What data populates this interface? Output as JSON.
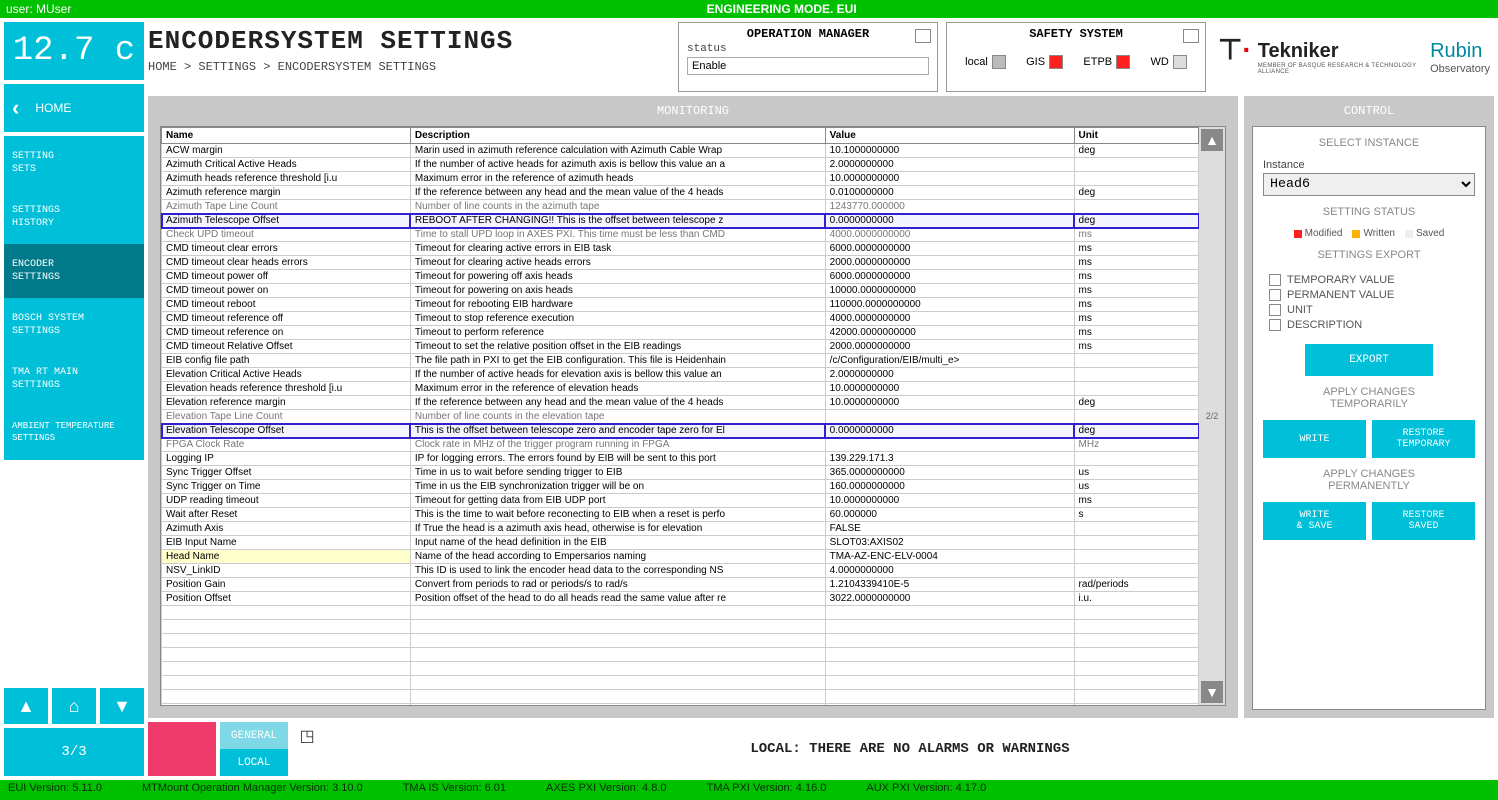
{
  "top": {
    "user": "user: MUser",
    "mode": "ENGINEERING MODE. EUI"
  },
  "version_badge": "12.7 c",
  "nav": {
    "back": "HOME",
    "items": [
      {
        "label": "SETTING\nSETS"
      },
      {
        "label": "SETTINGS\nHISTORY"
      },
      {
        "label": "ENCODER\nSETTINGS",
        "active": true
      },
      {
        "label": "BOSCH SYSTEM\nSETTINGS"
      },
      {
        "label": "TMA RT MAIN\nSETTINGS"
      },
      {
        "label": "AMBIENT TEMPERATURE\nSETTINGS",
        "small": true
      }
    ],
    "page": "3/3"
  },
  "title": "ENCODERSYSTEM SETTINGS",
  "breadcrumb": "HOME > SETTINGS > ENCODERSYSTEM SETTINGS",
  "op_mgr": {
    "title": "OPERATION MANAGER",
    "status_label": "status",
    "status_value": "Enable"
  },
  "safety": {
    "title": "SAFETY SYSTEM",
    "items": [
      {
        "label": "local",
        "color": "#bbb"
      },
      {
        "label": "GIS",
        "color": "#ff2020"
      },
      {
        "label": "ETPB",
        "color": "#ff2020"
      },
      {
        "label": "WD",
        "color": "#ddd"
      }
    ]
  },
  "logos": {
    "tek": "Tekniker",
    "tek_sub": "MEMBER OF BASQUE RESEARCH\n& TECHNOLOGY ALLIANCE",
    "rubin": "Rubin",
    "rubin_sub": "Observatory"
  },
  "monitoring": {
    "title": "MONITORING",
    "cols": [
      "Name",
      "Description",
      "Value",
      "Unit"
    ],
    "page": "2/2",
    "rows": [
      {
        "n": "ACW margin",
        "d": "Marin used in azimuth reference calculation with Azimuth Cable Wrap",
        "v": "10.1000000000",
        "u": "deg"
      },
      {
        "n": "Azimuth Critical Active Heads",
        "d": "If the number of active heads for azimuth axis is bellow this value an a",
        "v": "2.0000000000",
        "u": ""
      },
      {
        "n": "Azimuth heads reference threshold [i.u",
        "d": "Maximum error in the reference of azimuth heads",
        "v": "10.0000000000",
        "u": ""
      },
      {
        "n": "Azimuth reference margin",
        "d": "If the reference between any head and the mean value of the 4 heads",
        "v": "0.0100000000",
        "u": "deg"
      },
      {
        "n": "Azimuth Tape Line Count",
        "d": "Number of line counts in the azimuth tape",
        "v": "1243770.000000",
        "u": "",
        "obs": true
      },
      {
        "n": "Azimuth Telescope Offset",
        "d": "REBOOT AFTER CHANGING!! This is the offset between telescope z",
        "v": "0.0000000000",
        "u": "deg",
        "hl": true
      },
      {
        "n": "Check UPD timeout",
        "d": "Time to stall UPD loop in AXES PXI. This time must be less than CMD",
        "v": "4000.0000000000",
        "u": "ms",
        "obs": true
      },
      {
        "n": "CMD timeout clear errors",
        "d": "Timeout for  clearing active errors in EIB task",
        "v": "6000.0000000000",
        "u": "ms"
      },
      {
        "n": "CMD timeout clear heads errors",
        "d": "Timeout for  clearing active heads errors",
        "v": "2000.0000000000",
        "u": "ms"
      },
      {
        "n": "CMD timeout power off",
        "d": "Timeout for  powering off axis heads",
        "v": "6000.0000000000",
        "u": "ms"
      },
      {
        "n": "CMD timeout power on",
        "d": "Timeout for  powering on axis heads",
        "v": "10000.0000000000",
        "u": "ms"
      },
      {
        "n": "CMD timeout reboot",
        "d": "Timeout for rebooting EIB hardware",
        "v": "110000.0000000000",
        "u": "ms"
      },
      {
        "n": "CMD timeout reference off",
        "d": "Timeout to stop reference execution",
        "v": "4000.0000000000",
        "u": "ms"
      },
      {
        "n": "CMD timeout reference on",
        "d": "Timeout to perform reference",
        "v": "42000.0000000000",
        "u": "ms"
      },
      {
        "n": "CMD timeout Relative Offset",
        "d": "Timeout to set the relative position offset in the EIB readings",
        "v": "2000.0000000000",
        "u": "ms"
      },
      {
        "n": "EIB config file path",
        "d": "The file path in PXI to get the EIB configuration. This file is Heidenhain",
        "v": "/c/Configuration/EIB/multi_e>",
        "u": ""
      },
      {
        "n": "Elevation Critical Active Heads",
        "d": "If the number of active heads for elevation axis is bellow this value an",
        "v": "2.0000000000",
        "u": ""
      },
      {
        "n": "Elevation heads reference threshold [i.u",
        "d": "Maximum error in the reference of elevation heads",
        "v": "10.0000000000",
        "u": ""
      },
      {
        "n": "Elevation reference margin",
        "d": "If the reference between any head and the mean value of the 4 heads",
        "v": "10.0000000000",
        "u": "deg"
      },
      {
        "n": "Elevation Tape Line Count",
        "d": "Number of line counts in the elevation tape",
        "v": " ",
        "u": "",
        "obs": true
      },
      {
        "n": "Elevation Telescope Offset",
        "d": "This is the offset between telescope zero and encoder tape zero for El",
        "v": "0.0000000000",
        "u": "deg",
        "hl": true
      },
      {
        "n": "FPGA Clock Rate",
        "d": "Clock rate in MHz of the trigger program running in FPGA",
        "v": " ",
        "u": "MHz",
        "obs": true
      },
      {
        "n": "Logging IP",
        "d": "IP for logging errors. The errors found by EIB will be sent to this port",
        "v": "139.229.171.3",
        "u": ""
      },
      {
        "n": "Sync Trigger Offset",
        "d": "Time in us to wait before sending trigger to EIB",
        "v": "365.0000000000",
        "u": "us"
      },
      {
        "n": "Sync Trigger on Time",
        "d": "Time in us the EIB synchronization trigger will be on",
        "v": "160.0000000000",
        "u": "us"
      },
      {
        "n": "UDP reading timeout",
        "d": "Timeout for getting data from EIB UDP port",
        "v": "10.0000000000",
        "u": "ms"
      },
      {
        "n": "Wait after Reset",
        "d": "This is the time to wait before reconecting to EIB when a reset is perfo",
        "v": "60.000000",
        "u": "s"
      },
      {
        "n": "Azimuth Axis",
        "d": "If True the head is a azimuth axis head, otherwise is for elevation",
        "v": "FALSE",
        "u": ""
      },
      {
        "n": "EIB Input Name",
        "d": "Input name of the head definition in the EIB",
        "v": "SLOT03:AXIS02",
        "u": ""
      },
      {
        "n": "Head Name",
        "d": "Name of the head according to Empersarios naming",
        "v": "TMA-AZ-ENC-ELV-0004",
        "u": "",
        "yel": true
      },
      {
        "n": "NSV_LinkID",
        "d": "This ID is used to link the encoder head data to the corresponding NS",
        "v": "4.0000000000",
        "u": ""
      },
      {
        "n": "Position Gain",
        "d": "Convert from periods to rad or periods/s to rad/s",
        "v": "1.2104339410E-5",
        "u": "rad/periods"
      },
      {
        "n": "Position Offset",
        "d": "Position offset of the head to do all heads read the same value after re",
        "v": "3022.0000000000",
        "u": "i.u."
      }
    ]
  },
  "control": {
    "title": "CONTROL",
    "select_instance": "SELECT INSTANCE",
    "instance_label": "Instance",
    "instance_value": "Head6",
    "setting_status": "SETTING STATUS",
    "legend": [
      {
        "label": "Modified",
        "color": "#ff2020"
      },
      {
        "label": "Written",
        "color": "#ffb000"
      },
      {
        "label": "Saved",
        "color": "#eee"
      }
    ],
    "settings_export": "SETTINGS EXPORT",
    "export_opts": [
      "TEMPORARY VALUE",
      "PERMANENT VALUE",
      "UNIT",
      "DESCRIPTION"
    ],
    "export_btn": "EXPORT",
    "apply_temp": "APPLY CHANGES\nTEMPORARILY",
    "write_btn": "WRITE",
    "restore_temp_btn": "RESTORE\nTEMPORARY",
    "apply_perm": "APPLY CHANGES\nPERMANENTLY",
    "write_save_btn": "WRITE\n& SAVE",
    "restore_saved_btn": "RESTORE\nSAVED"
  },
  "footer": {
    "general": "GENERAL",
    "local": "LOCAL",
    "msg": "LOCAL: THERE ARE NO ALARMS OR WARNINGS"
  },
  "bottom": [
    "EUI Version: 5.11.0",
    "MTMount Operation Manager Version: 3.10.0",
    "TMA IS Version: 6.01",
    "AXES PXI Version: 4.8.0",
    "TMA PXI Version: 4.16.0",
    "AUX PXI Version: 4.17.0"
  ]
}
